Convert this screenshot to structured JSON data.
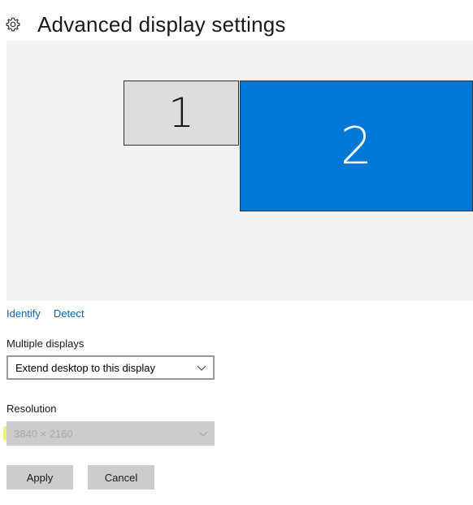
{
  "header": {
    "title": "Advanced display settings",
    "icon": "gear-icon"
  },
  "arrangement": {
    "monitors": [
      {
        "label": "1",
        "selected": false,
        "color": "#dddddd"
      },
      {
        "label": "2",
        "selected": true,
        "color": "#0078d7"
      }
    ],
    "background": "#f2f2f2"
  },
  "links": {
    "identify": "Identify",
    "detect": "Detect"
  },
  "multiple_displays": {
    "label": "Multiple displays",
    "value": "Extend desktop to this display"
  },
  "resolution": {
    "label": "Resolution",
    "value": "3840 × 2160",
    "disabled": true,
    "highlight_color": "#e6f233"
  },
  "buttons": {
    "apply": "Apply",
    "cancel": "Cancel"
  },
  "colors": {
    "accent": "#0078d7",
    "link": "#0067b8"
  }
}
